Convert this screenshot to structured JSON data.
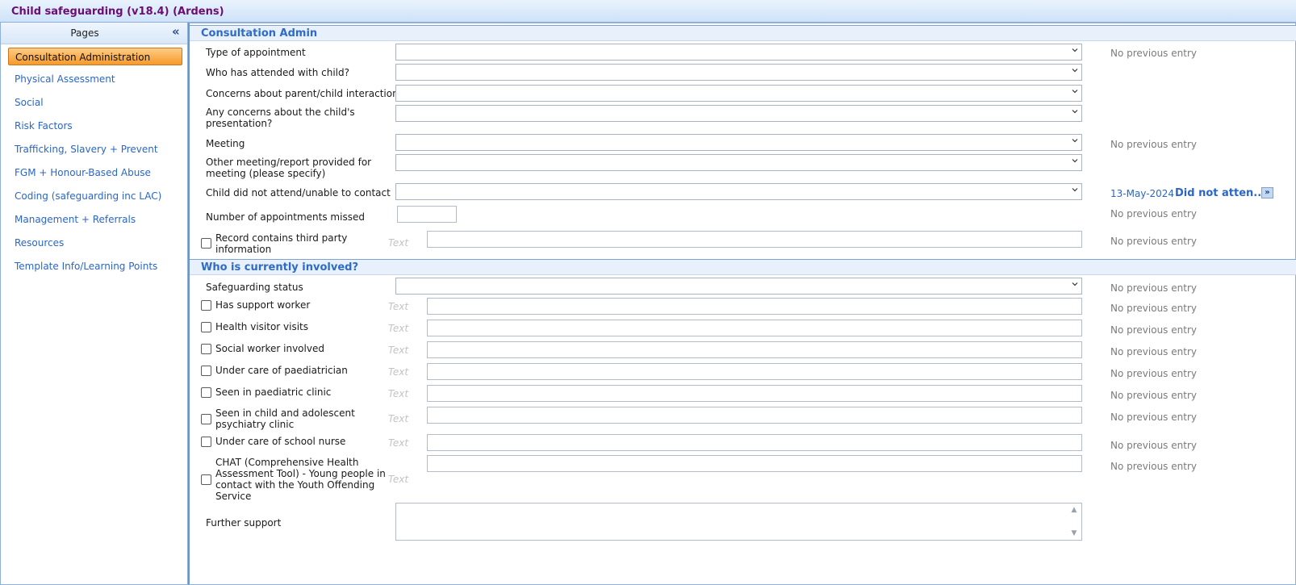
{
  "window": {
    "title": "Child safeguarding (v18.4) (Ardens)"
  },
  "sidebar": {
    "header": "Pages",
    "collapse_icon": "double-chevron-left-icon",
    "items": [
      {
        "label": "Consultation Administration",
        "active": true
      },
      {
        "label": "Physical Assessment"
      },
      {
        "label": "Social"
      },
      {
        "label": "Risk Factors"
      },
      {
        "label": "Trafficking, Slavery + Prevent"
      },
      {
        "label": "FGM + Honour-Based Abuse"
      },
      {
        "label": "Coding (safeguarding inc LAC)"
      },
      {
        "label": "Management + Referrals"
      },
      {
        "label": "Resources"
      },
      {
        "label": "Template Info/Learning Points"
      }
    ]
  },
  "consultation_admin": {
    "title": "Consultation Admin",
    "type_of_appointment": {
      "label": "Type of appointment",
      "value": "",
      "previous": "No previous entry"
    },
    "attended_with": {
      "label": "Who has attended with child?",
      "value": ""
    },
    "concerns_interaction": {
      "label": "Concerns about parent/child interaction",
      "value": ""
    },
    "concerns_presentation": {
      "label_line1": "Any concerns about the child's",
      "label_line2": "presentation?",
      "value": ""
    },
    "meeting": {
      "label": "Meeting",
      "value": "",
      "previous": "No previous entry"
    },
    "other_meeting": {
      "label_line1": "Other meeting/report provided for",
      "label_line2": "meeting (please specify)",
      "value": ""
    },
    "did_not_attend": {
      "label": "Child did not attend/unable to contact",
      "value": "",
      "previous_date": "13-May-2024",
      "previous_value": "Did not atten...",
      "expand_glyph": "»"
    },
    "appointments_missed": {
      "label": "Number of appointments missed",
      "value": "",
      "previous": "No previous entry"
    },
    "third_party": {
      "label_line1": "Record contains third party",
      "label_line2": "information",
      "checked": false,
      "placeholder": "Text",
      "value": "",
      "previous": "No previous entry"
    }
  },
  "who_involved": {
    "title": "Who is currently involved?",
    "safeguarding_status": {
      "label": "Safeguarding status",
      "value": "",
      "previous": "No previous entry"
    },
    "support_worker": {
      "label": "Has support worker",
      "checked": false,
      "placeholder": "Text",
      "previous": "No previous entry"
    },
    "health_visitor": {
      "label": "Health visitor visits",
      "checked": false,
      "placeholder": "Text",
      "previous": "No previous entry"
    },
    "social_worker": {
      "label": "Social worker involved",
      "checked": false,
      "placeholder": "Text",
      "previous": "No previous entry"
    },
    "paediatrician": {
      "label": "Under care of paediatrician",
      "checked": false,
      "placeholder": "Text",
      "previous": "No previous entry"
    },
    "paediatric_clinic": {
      "label": "Seen in paediatric clinic",
      "checked": false,
      "placeholder": "Text",
      "previous": "No previous entry"
    },
    "camhs": {
      "label_line1": "Seen in child and adolescent",
      "label_line2": "psychiatry clinic",
      "checked": false,
      "placeholder": "Text",
      "previous": "No previous entry"
    },
    "school_nurse": {
      "label": "Under care of school nurse",
      "checked": false,
      "placeholder": "Text",
      "previous": "No previous entry"
    },
    "chat": {
      "label_line1": "CHAT (Comprehensive Health",
      "label_line2": "Assessment Tool) - Young people in",
      "label_line3": "contact with the Youth Offending",
      "label_line4": "Service",
      "checked": false,
      "placeholder": "Text",
      "previous": "No previous entry"
    },
    "further_support": {
      "label": "Further support",
      "value": ""
    }
  },
  "colors": {
    "title": "#6a0e72",
    "link": "#2a66c7",
    "active_nav": "#f69a2a",
    "section_head": "#2e6bc7"
  }
}
